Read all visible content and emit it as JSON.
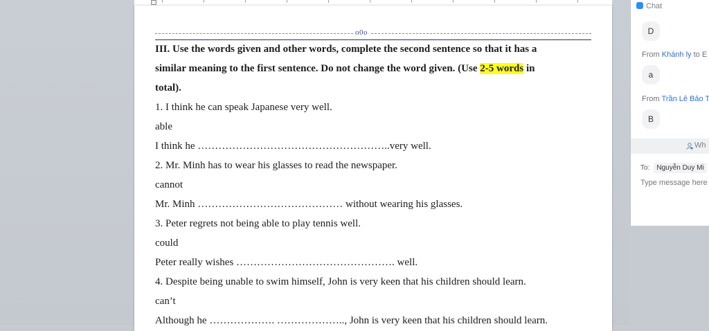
{
  "document": {
    "separator_mark": "o0o",
    "heading_line1": "III. Use the words given and other words, complete the second sentence so that it has a",
    "heading_line2_pre": "similar meaning to the first sentence. Do not change the word given. (Use ",
    "heading_highlight": "2-5 words",
    "heading_line2_post": " in",
    "heading_line3": "total).",
    "questions": [
      {
        "sentence": "1. I think he can speak Japanese very well.",
        "word": "able",
        "answer": "I think he ………………………………………………..very well."
      },
      {
        "sentence": "2. Mr. Minh has to wear his glasses to read the newspaper.",
        "word": "cannot",
        "answer": "Mr. Minh …………………………………… without wearing his glasses."
      },
      {
        "sentence": "3. Peter regrets not being able to play tennis well.",
        "word": "could",
        "answer": "Peter really wishes ………………………………………. well."
      },
      {
        "sentence": "4. Despite being unable to swim himself, John is very keen that his children should learn.",
        "word": "can’t",
        "answer": "Although he ………………. ……………….., John is very keen that his children should learn."
      }
    ],
    "highlight_color": "#ffff1a"
  },
  "chat": {
    "title": "Chat",
    "messages": [
      {
        "text": "D"
      },
      {
        "from_prefix": "From ",
        "from_name": "Khánh ly",
        "to_prefix": " to E",
        "text": "a"
      },
      {
        "from_prefix": "From ",
        "from_name": "Trần Lê Bảo T",
        "text": "B"
      }
    ],
    "who_label": "Wh",
    "to_label": "To:",
    "to_value": "Nguyễn Duy Mi",
    "input_placeholder": "Type message here",
    "accent_color": "#2d8cff"
  }
}
